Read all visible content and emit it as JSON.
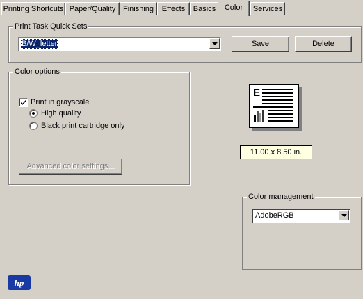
{
  "tabs": [
    {
      "label": "Printing Shortcuts"
    },
    {
      "label": "Paper/Quality"
    },
    {
      "label": "Finishing"
    },
    {
      "label": "Effects"
    },
    {
      "label": "Basics"
    },
    {
      "label": "Color",
      "active": true
    },
    {
      "label": "Services"
    }
  ],
  "quick_sets": {
    "legend": "Print Task Quick Sets",
    "selected": "B/W_letter",
    "save_label": "Save",
    "delete_label": "Delete"
  },
  "color_options": {
    "legend": "Color options",
    "grayscale_label": "Print in grayscale",
    "grayscale_checked": true,
    "high_quality_label": "High quality",
    "high_quality_selected": true,
    "black_cartridge_label": "Black print cartridge only",
    "black_cartridge_selected": false,
    "advanced_label": "Advanced color settings..."
  },
  "preview": {
    "page_letter": "E",
    "size_label": "11.00 x 8.50 in."
  },
  "color_management": {
    "legend": "Color management",
    "selected": "AdobeRGB"
  },
  "logo": {
    "text": "hp",
    "color": "#1a3aa3"
  }
}
